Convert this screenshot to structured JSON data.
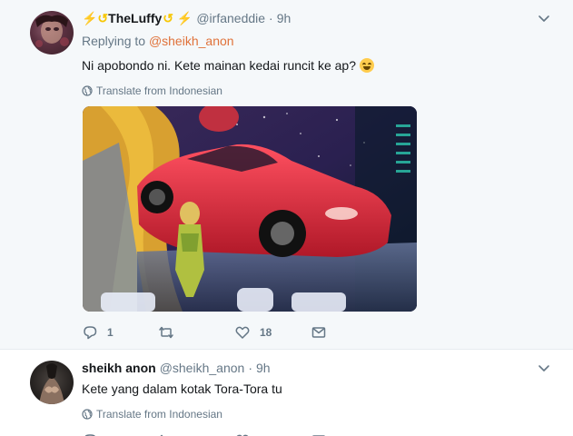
{
  "tweets": [
    {
      "name": "TheLuffy",
      "name_prefix": "⚡↺",
      "name_suffix": "↺ ⚡",
      "handle": "@irfaneddie",
      "dot": "·",
      "time": "9h",
      "replying_label": "Replying to",
      "replying_to": "@sheikh_anon",
      "text": "Ni apobondo ni. Kete mainan kedai runcit ke ap?",
      "translate_label": "Translate from Indonesian",
      "has_media": true,
      "actions": {
        "replies": "1",
        "retweets": "",
        "likes": "18"
      }
    },
    {
      "name": "sheikh anon",
      "handle": "@sheikh_anon",
      "dot": "·",
      "time": "9h",
      "text": "Kete yang dalam kotak Tora-Tora tu",
      "translate_label": "Translate from Indonesian",
      "actions": {
        "replies": "",
        "retweets": "",
        "likes": ""
      }
    }
  ],
  "colors": {
    "mention": "#e0723a",
    "muted": "#657786",
    "thread_line": "#ccd6dd",
    "bolt": "#f7c600"
  },
  "icons": [
    "reply-icon",
    "retweet-icon",
    "like-icon",
    "dm-icon",
    "globe-icon",
    "chevron-down-icon"
  ]
}
